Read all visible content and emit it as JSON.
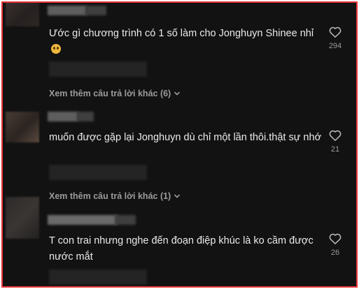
{
  "comments": [
    {
      "text": "Ước gì chương trình có 1 số làm cho Jonghuyn Shinee nhỉ",
      "emoji_icon": "sad-face-emoji",
      "likes": "294",
      "more_replies": "Xem thêm câu trả lời khác (6)"
    },
    {
      "text": "muốn được gặp lại Jonghuyn dù chỉ một lần thôi.thật sự nhớ",
      "likes": "21",
      "more_replies": "Xem thêm câu trả lời khác (1)"
    },
    {
      "text": "T con trai nhưng nghe đến đoạn điệp khúc là ko cầm được nước mắt",
      "likes": "26"
    }
  ],
  "colors": {
    "background": "#121212",
    "frame_border": "#e8343a",
    "text": "#eaeaea",
    "secondary_text": "#9b9b9b"
  },
  "icons": [
    "heart-icon",
    "chevron-down-icon"
  ]
}
